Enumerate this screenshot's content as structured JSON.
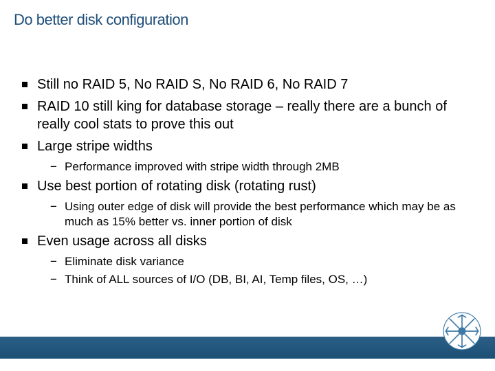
{
  "title": "Do better disk configuration",
  "bullets": {
    "b1": "Still no RAID 5, No RAID S, No RAID 6, No RAID 7",
    "b2": "RAID 10 still king for database storage – really there are a bunch of really cool stats to prove this out",
    "b3": "Large stripe widths",
    "b3s1": "Performance improved with stripe width through 2MB",
    "b4": "Use best portion of rotating disk (rotating rust)",
    "b4s1": "Using outer edge of disk will provide the best performance which may be as much as 15% better vs. inner portion of disk",
    "b5": "Even usage across all disks",
    "b5s1": "Eliminate disk variance",
    "b5s2": "Think of ALL sources of I/O (DB, BI, AI, Temp files, OS, …)"
  }
}
